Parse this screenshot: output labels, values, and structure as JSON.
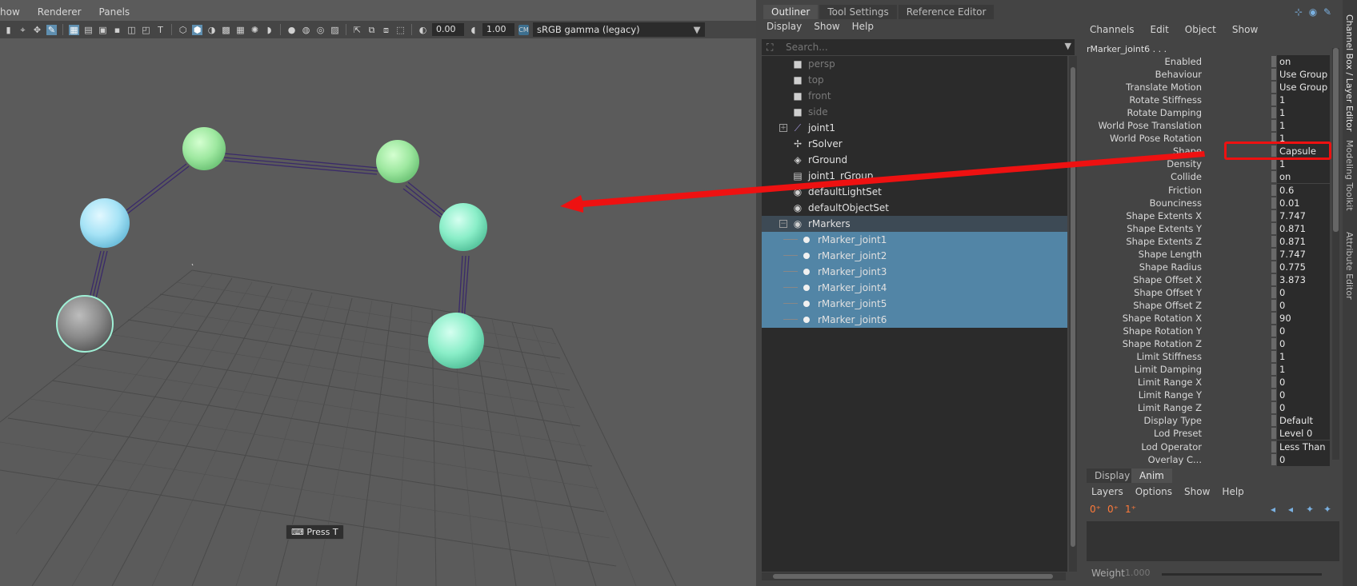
{
  "viewport": {
    "menus": [
      "how",
      "Renderer",
      "Panels"
    ],
    "exposure": "0.00",
    "gamma": "1.00",
    "color_space": "sRGB gamma (legacy)",
    "hud_label": "Press T"
  },
  "outliner": {
    "tabs": [
      "Outliner",
      "Tool Settings",
      "Reference Editor"
    ],
    "menus": [
      "Display",
      "Show",
      "Help"
    ],
    "search_placeholder": "Search...",
    "items": [
      {
        "label": "persp",
        "icon": "camera-icon",
        "dim": true
      },
      {
        "label": "top",
        "icon": "camera-icon",
        "dim": true
      },
      {
        "label": "front",
        "icon": "camera-icon",
        "dim": true
      },
      {
        "label": "side",
        "icon": "camera-icon",
        "dim": true
      },
      {
        "label": "joint1",
        "icon": "joint-icon",
        "expandable": true
      },
      {
        "label": "rSolver",
        "icon": "solver-icon"
      },
      {
        "label": "rGround",
        "icon": "ground-icon"
      },
      {
        "label": "joint1_rGroup",
        "icon": "group-icon"
      },
      {
        "label": "defaultLightSet",
        "icon": "set-icon"
      },
      {
        "label": "defaultObjectSet",
        "icon": "set-icon"
      },
      {
        "label": "rMarkers",
        "icon": "set-icon",
        "expanded": true
      },
      {
        "label": "rMarker_joint1"
      },
      {
        "label": "rMarker_joint2"
      },
      {
        "label": "rMarker_joint3"
      },
      {
        "label": "rMarker_joint4"
      },
      {
        "label": "rMarker_joint5"
      },
      {
        "label": "rMarker_joint6"
      }
    ]
  },
  "channelbox": {
    "menus": [
      "Channels",
      "Edit",
      "Object",
      "Show"
    ],
    "object_name": "rMarker_joint6 . . .",
    "attributes": [
      {
        "label": "Enabled",
        "value": "on"
      },
      {
        "label": "Behaviour",
        "value": "Use Group"
      },
      {
        "label": "Translate Motion",
        "value": "Use Group"
      },
      {
        "label": "Rotate Stiffness",
        "value": "1"
      },
      {
        "label": "Rotate Damping",
        "value": "1"
      },
      {
        "label": "World Pose Translation",
        "value": "1"
      },
      {
        "label": "World Pose Rotation",
        "value": "1"
      },
      {
        "label": "Shape",
        "value": "Capsule"
      },
      {
        "label": "Density",
        "value": "1"
      },
      {
        "label": "Collide",
        "value": "on"
      },
      {
        "label": "Friction",
        "value": "0.6"
      },
      {
        "label": "Bounciness",
        "value": "0.01"
      },
      {
        "label": "Shape Extents X",
        "value": "7.747"
      },
      {
        "label": "Shape Extents Y",
        "value": "0.871"
      },
      {
        "label": "Shape Extents Z",
        "value": "0.871"
      },
      {
        "label": "Shape Length",
        "value": "7.747"
      },
      {
        "label": "Shape Radius",
        "value": "0.775"
      },
      {
        "label": "Shape Offset X",
        "value": "3.873"
      },
      {
        "label": "Shape Offset Y",
        "value": "0"
      },
      {
        "label": "Shape Offset Z",
        "value": "0"
      },
      {
        "label": "Shape Rotation X",
        "value": "90"
      },
      {
        "label": "Shape Rotation Y",
        "value": "0"
      },
      {
        "label": "Shape Rotation Z",
        "value": "0"
      },
      {
        "label": "Limit Stiffness",
        "value": "1"
      },
      {
        "label": "Limit Damping",
        "value": "1"
      },
      {
        "label": "Limit Range X",
        "value": "0"
      },
      {
        "label": "Limit Range Y",
        "value": "0"
      },
      {
        "label": "Limit Range Z",
        "value": "0"
      },
      {
        "label": "Display Type",
        "value": "Default"
      },
      {
        "label": "Lod Preset",
        "value": "Level 0"
      },
      {
        "label": "Lod Operator",
        "value": "Less Than"
      },
      {
        "label": "Overlay C...",
        "value": "0"
      }
    ]
  },
  "layer_editor": {
    "tabs": [
      "Display",
      "Anim"
    ],
    "active_tab": "Anim",
    "menus": [
      "Layers",
      "Options",
      "Show",
      "Help"
    ],
    "weight_label": "Weight",
    "weight_value": "1.000"
  },
  "side_tabs": [
    "Channel Box / Layer Editor",
    "Modeling Toolkit",
    "Attribute Editor"
  ],
  "colors": {
    "selection": "#5285a6",
    "highlight": "#ee1111"
  }
}
